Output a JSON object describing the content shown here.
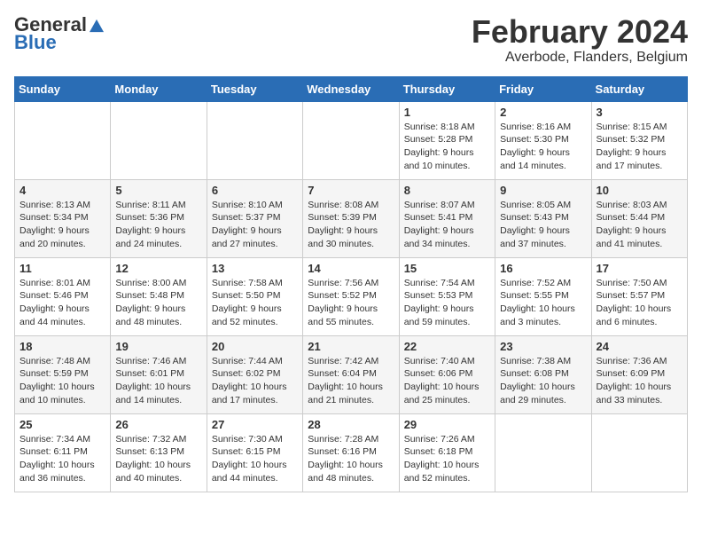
{
  "header": {
    "logo_general": "General",
    "logo_blue": "Blue",
    "title": "February 2024",
    "subtitle": "Averbode, Flanders, Belgium"
  },
  "days_of_week": [
    "Sunday",
    "Monday",
    "Tuesday",
    "Wednesday",
    "Thursday",
    "Friday",
    "Saturday"
  ],
  "weeks": [
    [
      {
        "day": "",
        "info": ""
      },
      {
        "day": "",
        "info": ""
      },
      {
        "day": "",
        "info": ""
      },
      {
        "day": "",
        "info": ""
      },
      {
        "day": "1",
        "info": "Sunrise: 8:18 AM\nSunset: 5:28 PM\nDaylight: 9 hours\nand 10 minutes."
      },
      {
        "day": "2",
        "info": "Sunrise: 8:16 AM\nSunset: 5:30 PM\nDaylight: 9 hours\nand 14 minutes."
      },
      {
        "day": "3",
        "info": "Sunrise: 8:15 AM\nSunset: 5:32 PM\nDaylight: 9 hours\nand 17 minutes."
      }
    ],
    [
      {
        "day": "4",
        "info": "Sunrise: 8:13 AM\nSunset: 5:34 PM\nDaylight: 9 hours\nand 20 minutes."
      },
      {
        "day": "5",
        "info": "Sunrise: 8:11 AM\nSunset: 5:36 PM\nDaylight: 9 hours\nand 24 minutes."
      },
      {
        "day": "6",
        "info": "Sunrise: 8:10 AM\nSunset: 5:37 PM\nDaylight: 9 hours\nand 27 minutes."
      },
      {
        "day": "7",
        "info": "Sunrise: 8:08 AM\nSunset: 5:39 PM\nDaylight: 9 hours\nand 30 minutes."
      },
      {
        "day": "8",
        "info": "Sunrise: 8:07 AM\nSunset: 5:41 PM\nDaylight: 9 hours\nand 34 minutes."
      },
      {
        "day": "9",
        "info": "Sunrise: 8:05 AM\nSunset: 5:43 PM\nDaylight: 9 hours\nand 37 minutes."
      },
      {
        "day": "10",
        "info": "Sunrise: 8:03 AM\nSunset: 5:44 PM\nDaylight: 9 hours\nand 41 minutes."
      }
    ],
    [
      {
        "day": "11",
        "info": "Sunrise: 8:01 AM\nSunset: 5:46 PM\nDaylight: 9 hours\nand 44 minutes."
      },
      {
        "day": "12",
        "info": "Sunrise: 8:00 AM\nSunset: 5:48 PM\nDaylight: 9 hours\nand 48 minutes."
      },
      {
        "day": "13",
        "info": "Sunrise: 7:58 AM\nSunset: 5:50 PM\nDaylight: 9 hours\nand 52 minutes."
      },
      {
        "day": "14",
        "info": "Sunrise: 7:56 AM\nSunset: 5:52 PM\nDaylight: 9 hours\nand 55 minutes."
      },
      {
        "day": "15",
        "info": "Sunrise: 7:54 AM\nSunset: 5:53 PM\nDaylight: 9 hours\nand 59 minutes."
      },
      {
        "day": "16",
        "info": "Sunrise: 7:52 AM\nSunset: 5:55 PM\nDaylight: 10 hours\nand 3 minutes."
      },
      {
        "day": "17",
        "info": "Sunrise: 7:50 AM\nSunset: 5:57 PM\nDaylight: 10 hours\nand 6 minutes."
      }
    ],
    [
      {
        "day": "18",
        "info": "Sunrise: 7:48 AM\nSunset: 5:59 PM\nDaylight: 10 hours\nand 10 minutes."
      },
      {
        "day": "19",
        "info": "Sunrise: 7:46 AM\nSunset: 6:01 PM\nDaylight: 10 hours\nand 14 minutes."
      },
      {
        "day": "20",
        "info": "Sunrise: 7:44 AM\nSunset: 6:02 PM\nDaylight: 10 hours\nand 17 minutes."
      },
      {
        "day": "21",
        "info": "Sunrise: 7:42 AM\nSunset: 6:04 PM\nDaylight: 10 hours\nand 21 minutes."
      },
      {
        "day": "22",
        "info": "Sunrise: 7:40 AM\nSunset: 6:06 PM\nDaylight: 10 hours\nand 25 minutes."
      },
      {
        "day": "23",
        "info": "Sunrise: 7:38 AM\nSunset: 6:08 PM\nDaylight: 10 hours\nand 29 minutes."
      },
      {
        "day": "24",
        "info": "Sunrise: 7:36 AM\nSunset: 6:09 PM\nDaylight: 10 hours\nand 33 minutes."
      }
    ],
    [
      {
        "day": "25",
        "info": "Sunrise: 7:34 AM\nSunset: 6:11 PM\nDaylight: 10 hours\nand 36 minutes."
      },
      {
        "day": "26",
        "info": "Sunrise: 7:32 AM\nSunset: 6:13 PM\nDaylight: 10 hours\nand 40 minutes."
      },
      {
        "day": "27",
        "info": "Sunrise: 7:30 AM\nSunset: 6:15 PM\nDaylight: 10 hours\nand 44 minutes."
      },
      {
        "day": "28",
        "info": "Sunrise: 7:28 AM\nSunset: 6:16 PM\nDaylight: 10 hours\nand 48 minutes."
      },
      {
        "day": "29",
        "info": "Sunrise: 7:26 AM\nSunset: 6:18 PM\nDaylight: 10 hours\nand 52 minutes."
      },
      {
        "day": "",
        "info": ""
      },
      {
        "day": "",
        "info": ""
      }
    ]
  ]
}
